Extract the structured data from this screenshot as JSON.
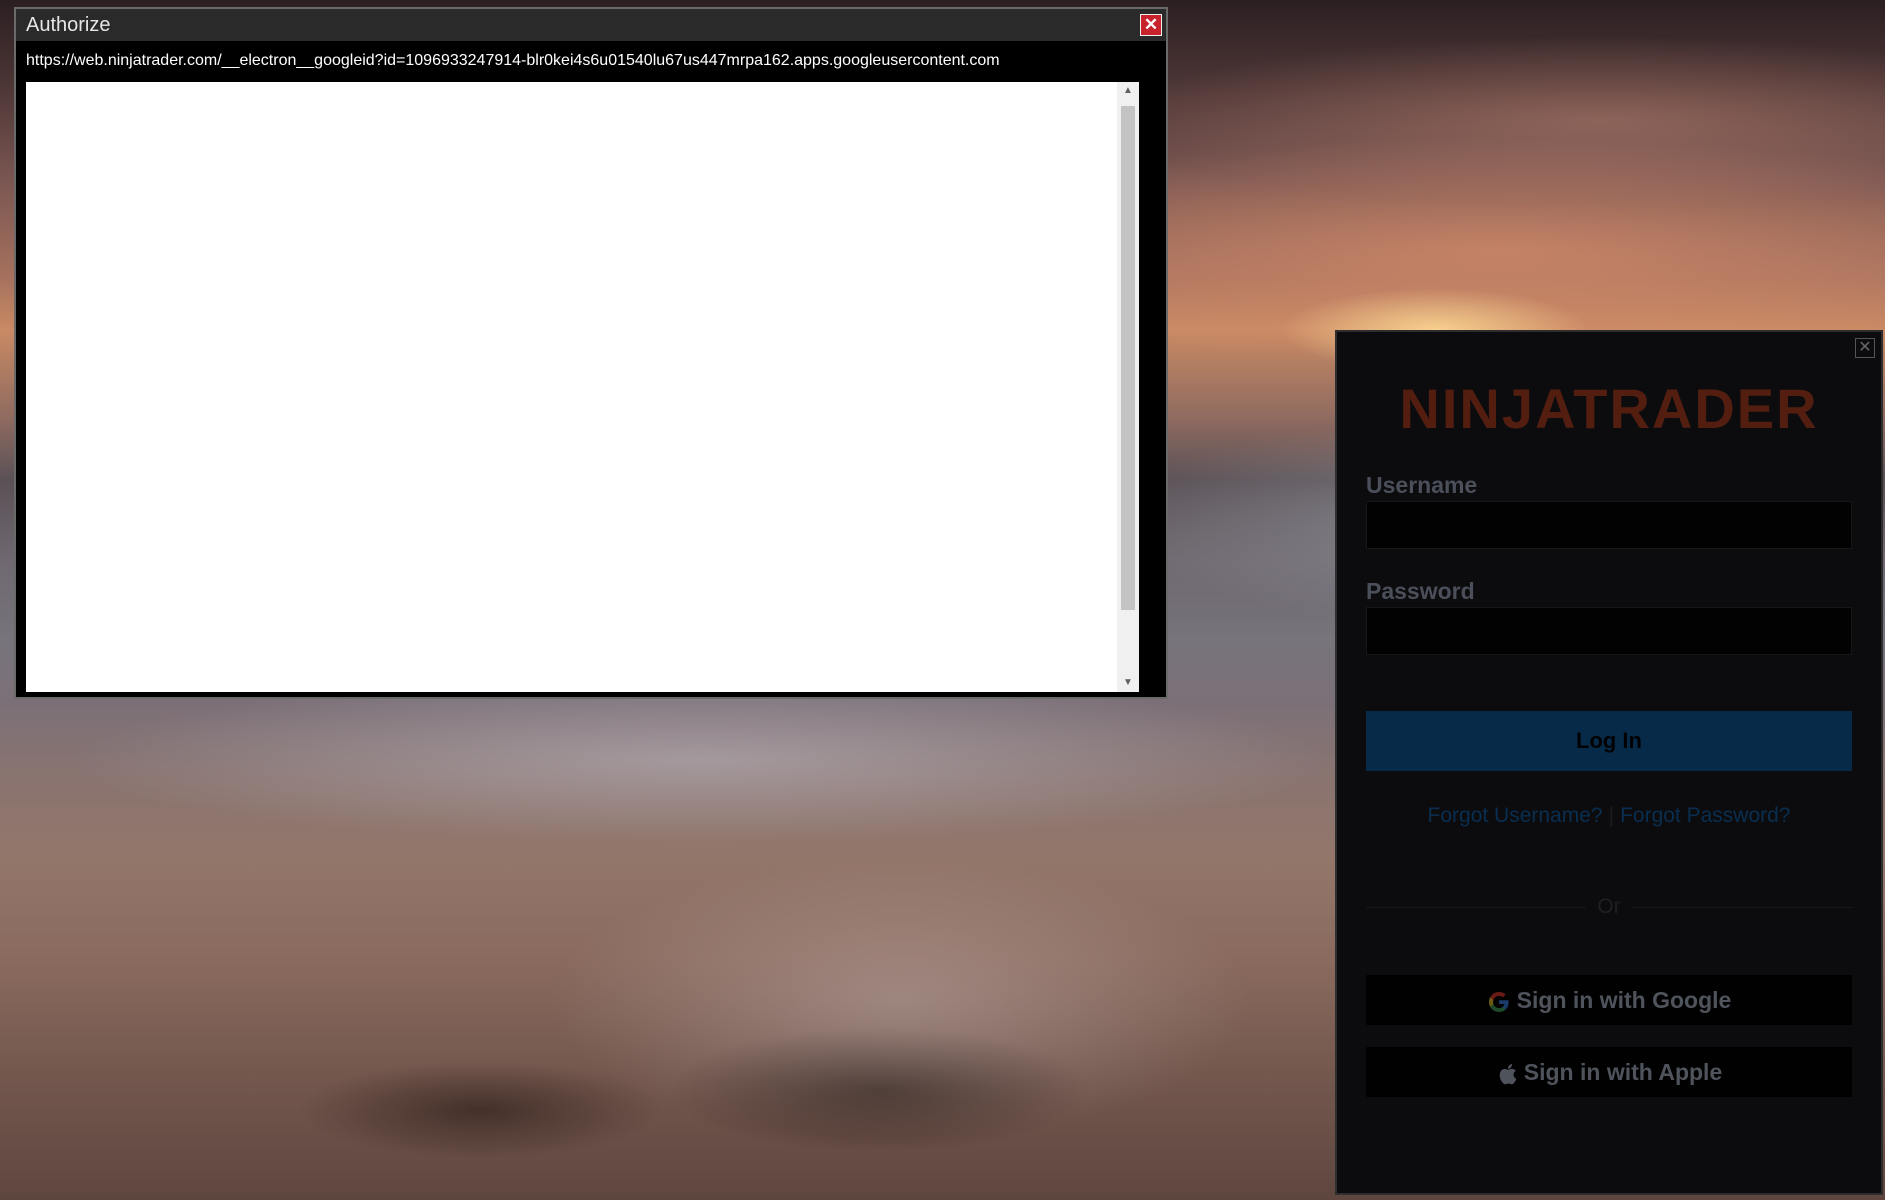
{
  "auth_window": {
    "title": "Authorize",
    "close_glyph": "✕",
    "url": "https://web.ninjatrader.com/__electron__googleid?id=1096933247914-blr0kei4s6u01540lu67us447mrpa162.apps.googleusercontent.com",
    "scroll_up_glyph": "▲",
    "scroll_down_glyph": "▼"
  },
  "login": {
    "close_glyph": "✕",
    "logo_text": "NINJATRADER",
    "username_label": "Username",
    "username_value": "",
    "password_label": "Password",
    "password_value": "",
    "login_button": "Log In",
    "forgot_username": "Forgot Username?",
    "separator": "|",
    "forgot_password": "Forgot Password?",
    "or_text": "Or",
    "google_button": "Sign in with Google",
    "apple_button": "Sign in with Apple",
    "icons": [
      "google-icon",
      "apple-icon"
    ]
  }
}
